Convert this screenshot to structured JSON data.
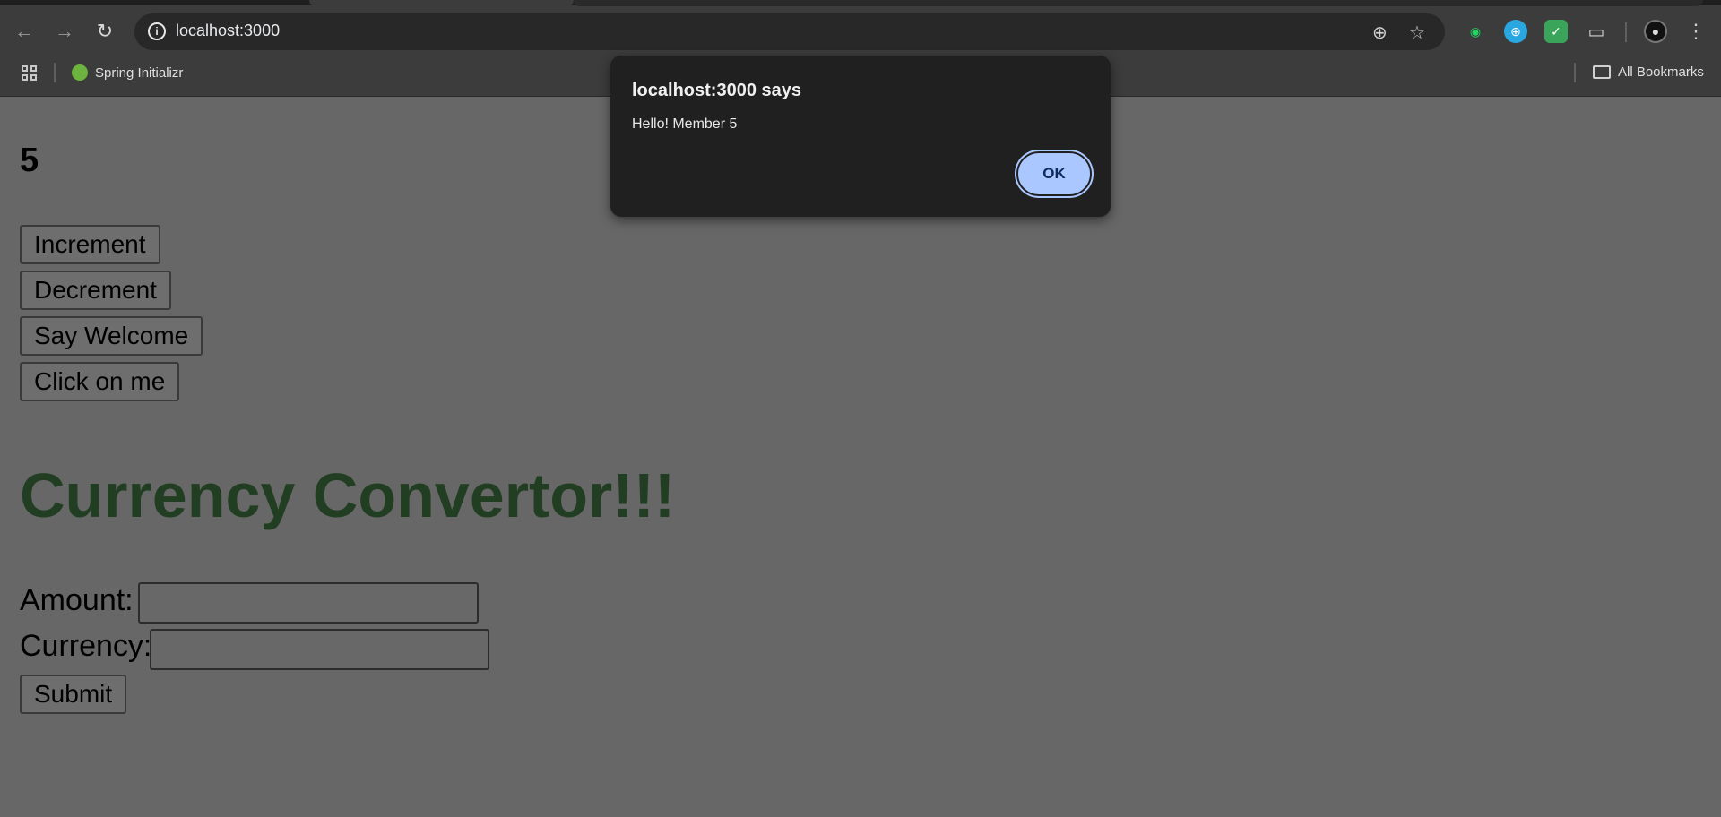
{
  "browser": {
    "url": "localhost:3000",
    "bookmarks": [
      {
        "label": "Spring Initializr"
      }
    ],
    "all_bookmarks_label": "All Bookmarks"
  },
  "app": {
    "counter_value": "5",
    "buttons": {
      "increment": "Increment",
      "decrement": "Decrement",
      "say_welcome": "Say Welcome",
      "click_on_me": "Click on me"
    },
    "heading": "Currency Convertor!!!",
    "form": {
      "amount_label": "Amount:",
      "amount_value": "",
      "currency_label": "Currency:",
      "currency_value": "",
      "submit_label": "Submit"
    }
  },
  "dialog": {
    "title": "localhost:3000 says",
    "message": "Hello! Member 5",
    "ok_label": "OK"
  }
}
